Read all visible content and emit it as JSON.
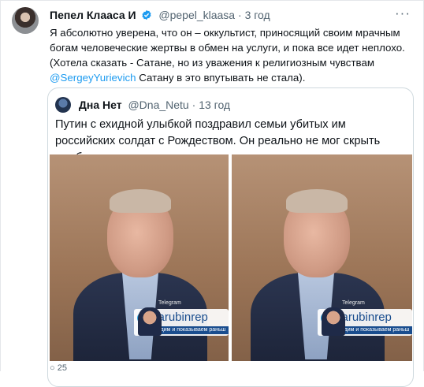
{
  "tweet": {
    "author_name": "Пепел Клааса",
    "author_badge": "И",
    "handle": "@pepel_klaasa",
    "separator": "·",
    "time": "3 год",
    "more_icon": "more-icon",
    "text_part1": "Я абсолютно уверена, что он – оккультист, приносящий своим мрачным богам человеческие жертвы в обмен на услуги, и пока все идет неплохо. (Хотела сказать - Сатане, но из уважения к религиозным чувствам ",
    "mention": "@SergeyYurievich",
    "text_part2": " Сатану в это впутывать не стала)."
  },
  "quoted": {
    "author_name": "Дна Нет",
    "handle": "@Dna_Netu",
    "separator": "·",
    "time": "13 год",
    "text": "Путин с ехидной улыбкой поздравил семьи убитых им российских солдат с Рождеством. Он реально не мог скрыть улыбку.",
    "watermark": {
      "top_label": "Telegram",
      "channel": "zarubinrep",
      "subtitle": "видим и показываем раньш"
    }
  },
  "footer": {
    "reply_count": "25"
  },
  "colors": {
    "accent": "#1d9bf0",
    "muted": "#536471",
    "border": "#cfd9de"
  }
}
